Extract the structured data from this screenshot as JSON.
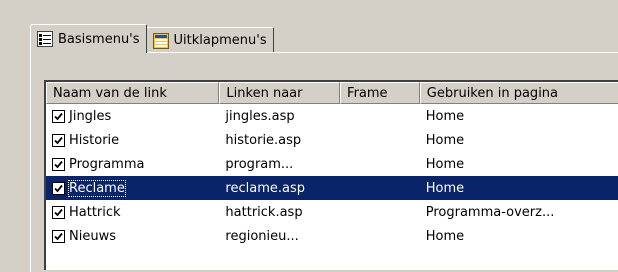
{
  "tabs": [
    {
      "label": "Basismenu's",
      "icon": "list-menu-icon",
      "active": true
    },
    {
      "label": "Uitklapmenu's",
      "icon": "dropdown-menu-icon",
      "active": false
    }
  ],
  "columns": [
    "Naam van de link",
    "Linken naar",
    "Frame",
    "Gebruiken in pagina"
  ],
  "rows": [
    {
      "name": "Jingles",
      "link": "jingles.asp",
      "frame": "",
      "page": "Home",
      "checked": true
    },
    {
      "name": "Historie",
      "link": "historie.asp",
      "frame": "",
      "page": "Home",
      "checked": true
    },
    {
      "name": "Programma",
      "link": "program...",
      "frame": "",
      "page": "Home",
      "checked": true
    },
    {
      "name": "Reclame",
      "link": "reclame.asp",
      "frame": "",
      "page": "Home",
      "checked": true,
      "selected": true
    },
    {
      "name": "Hattrick",
      "link": "hattrick.asp",
      "frame": "",
      "page": "Programma-overz...",
      "checked": true
    },
    {
      "name": "Nieuws",
      "link": "regionieu...",
      "frame": "",
      "page": "Home",
      "checked": true
    }
  ],
  "colors": {
    "selection": "#0a246a",
    "face": "#d4d0c8"
  }
}
